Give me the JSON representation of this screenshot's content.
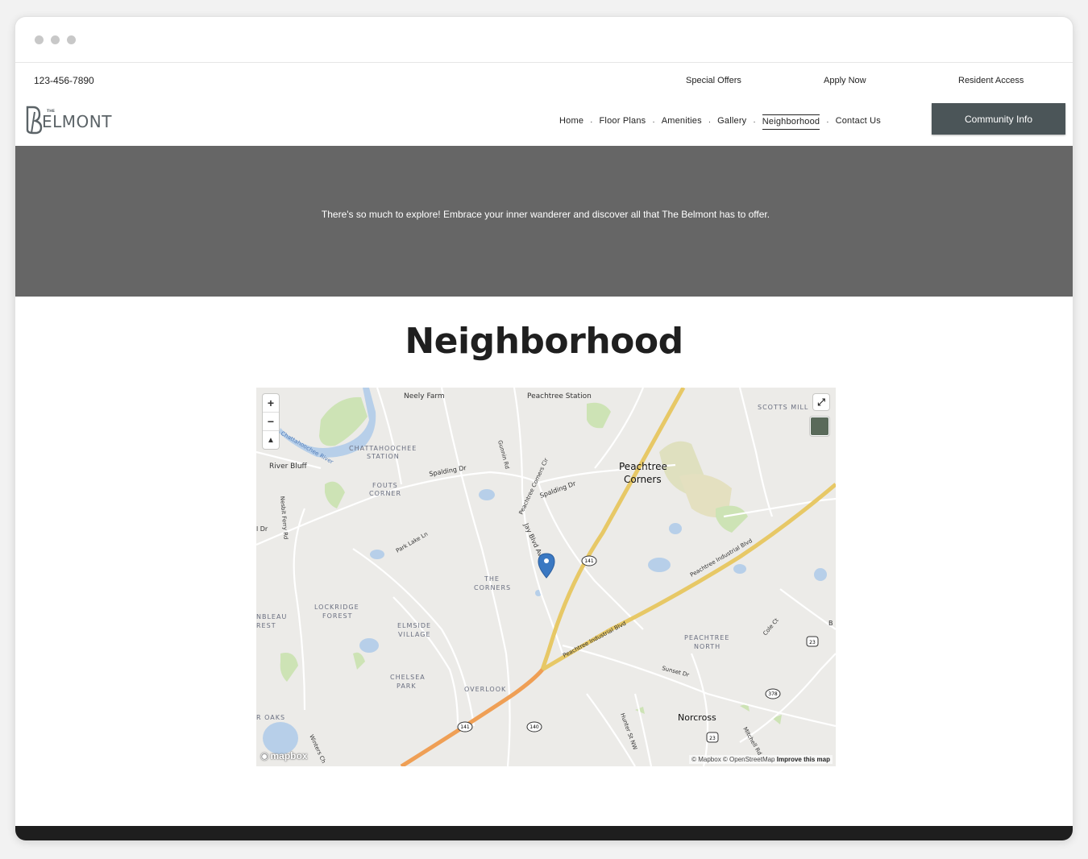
{
  "topbar": {
    "phone": "123-456-7890",
    "links": [
      "Special Offers",
      "Apply Now",
      "Resident Access"
    ]
  },
  "logo": {
    "small": "THE",
    "brand": "ELMONT",
    "initial": "B"
  },
  "nav": {
    "items": [
      "Home",
      "Floor Plans",
      "Amenities",
      "Gallery",
      "Neighborhood",
      "Contact Us"
    ],
    "active": "Neighborhood",
    "cta": "Community Info"
  },
  "hero": {
    "text": "There's so much to explore! Embrace your inner wanderer and discover all that The Belmont has to offer."
  },
  "main": {
    "title": "Neighborhood"
  },
  "map": {
    "controls": {
      "zoom_in": "+",
      "zoom_out": "−",
      "compass": "▲"
    },
    "logo_text": "mapbox",
    "attribution": "© Mapbox © OpenStreetMap",
    "improve": "Improve this map",
    "labels": {
      "neely_farm": "Neely Farm",
      "peachtree_station": "Peachtree Station",
      "scotts_mill": "SCOTTS MILL",
      "chattahoochee_station_1": "CHATTAHOOCHEE",
      "chattahoochee_station_2": "STATION",
      "chattahoochee_river": "Chattahoochee River",
      "river_bluff": "River Bluff",
      "spalding_dr_1": "Spalding Dr",
      "spalding_dr_2": "Spalding Dr",
      "fouts_corner_1": "FOUTS",
      "fouts_corner_2": "CORNER",
      "peachtree_corners_1": "Peachtree",
      "peachtree_corners_2": "Corners",
      "peachtree_corners_cir": "Peachtree Corners Cir",
      "gunnin_rd": "Gunnin Rd",
      "nesbit_ferry": "Nesbit Ferry Rd",
      "dr_fragment": "l Dr",
      "park_lake": "Park Lake Ln",
      "jay_blvd": "Jay Blvd Av",
      "route_141_a": "141",
      "the_corners_1": "THE",
      "the_corners_2": "CORNERS",
      "peachtree_industrial_1": "Peachtree Industrial Blvd",
      "peachtree_industrial_2": "Peachtree Industrial Blvd",
      "lockridge_1": "LOCKRIDGE",
      "lockridge_2": "FOREST",
      "fontainebleau_1": "NBLEAU",
      "fontainebleau_2": "REST",
      "elmside_1": "ELMSIDE",
      "elmside_2": "VILLAGE",
      "peachtree_north_1": "PEACHTREE",
      "peachtree_north_2": "NORTH",
      "cole_ct": "Cole Ct",
      "route_23_a": "23",
      "sunset_dr": "Sunset Dr",
      "chelsea_1": "CHELSEA",
      "chelsea_2": "PARK",
      "overlook": "OVERLOOK",
      "route_378": "378",
      "norcross": "Norcross",
      "oaks": "R OAKS",
      "route_141_b": "141",
      "route_140": "140",
      "hunter_st": "Hunter St NW",
      "route_23_b": "23",
      "mitchell": "Mitchell Rd",
      "winters": "Winters Ch",
      "b_fragment": "B"
    }
  }
}
